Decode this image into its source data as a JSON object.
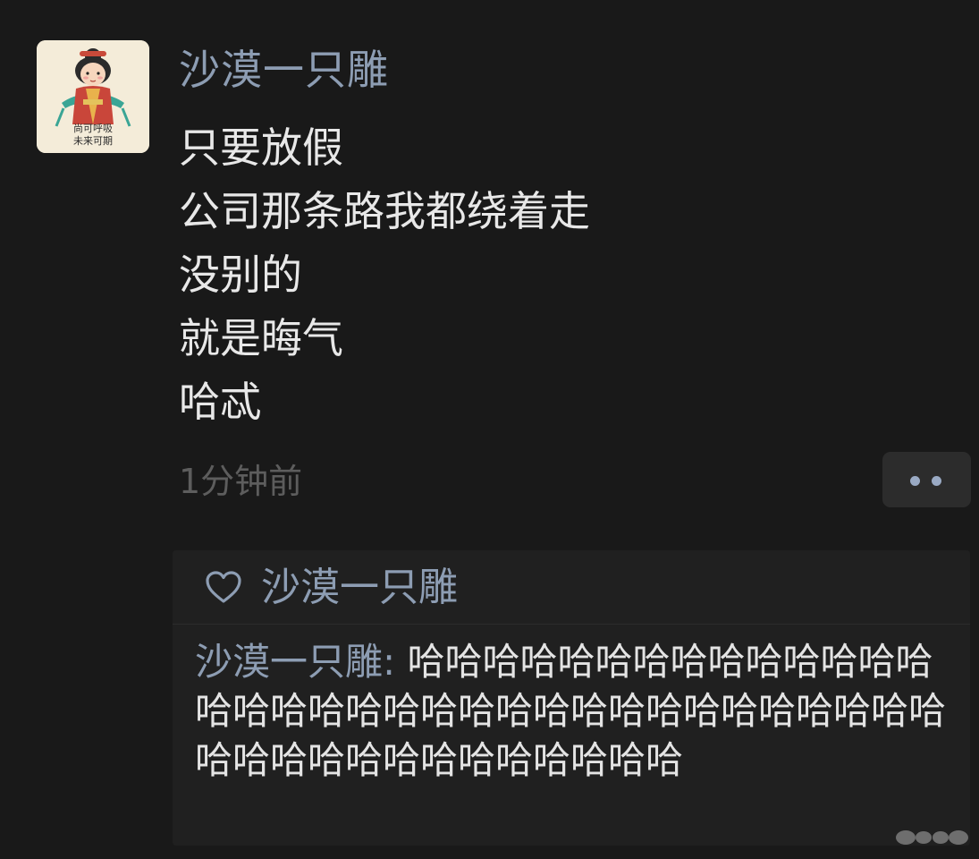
{
  "post": {
    "author_name": "沙漠一只雕",
    "avatar_caption": [
      "尚可呼吸",
      "未来可期"
    ],
    "lines": [
      "只要放假",
      "公司那条路我都绕着走",
      "没别的",
      "就是晦气",
      "哈忒"
    ],
    "timestamp": "1分钟前"
  },
  "likes": {
    "icon": "heart-icon",
    "names": "沙漠一只雕"
  },
  "comments": [
    {
      "author": "沙漠一只雕",
      "separator": ": ",
      "text": "哈哈哈哈哈哈哈哈哈哈哈哈哈哈哈哈哈哈哈哈哈哈哈哈哈哈哈哈哈哈哈哈哈哈哈哈哈哈哈哈哈哈哈哈哈哈哈"
    }
  ],
  "colors": {
    "background": "#191919",
    "name_blue": "#8d9db3",
    "text": "#e8e8e8",
    "muted": "#5d5d5d",
    "panel": "#202020"
  }
}
